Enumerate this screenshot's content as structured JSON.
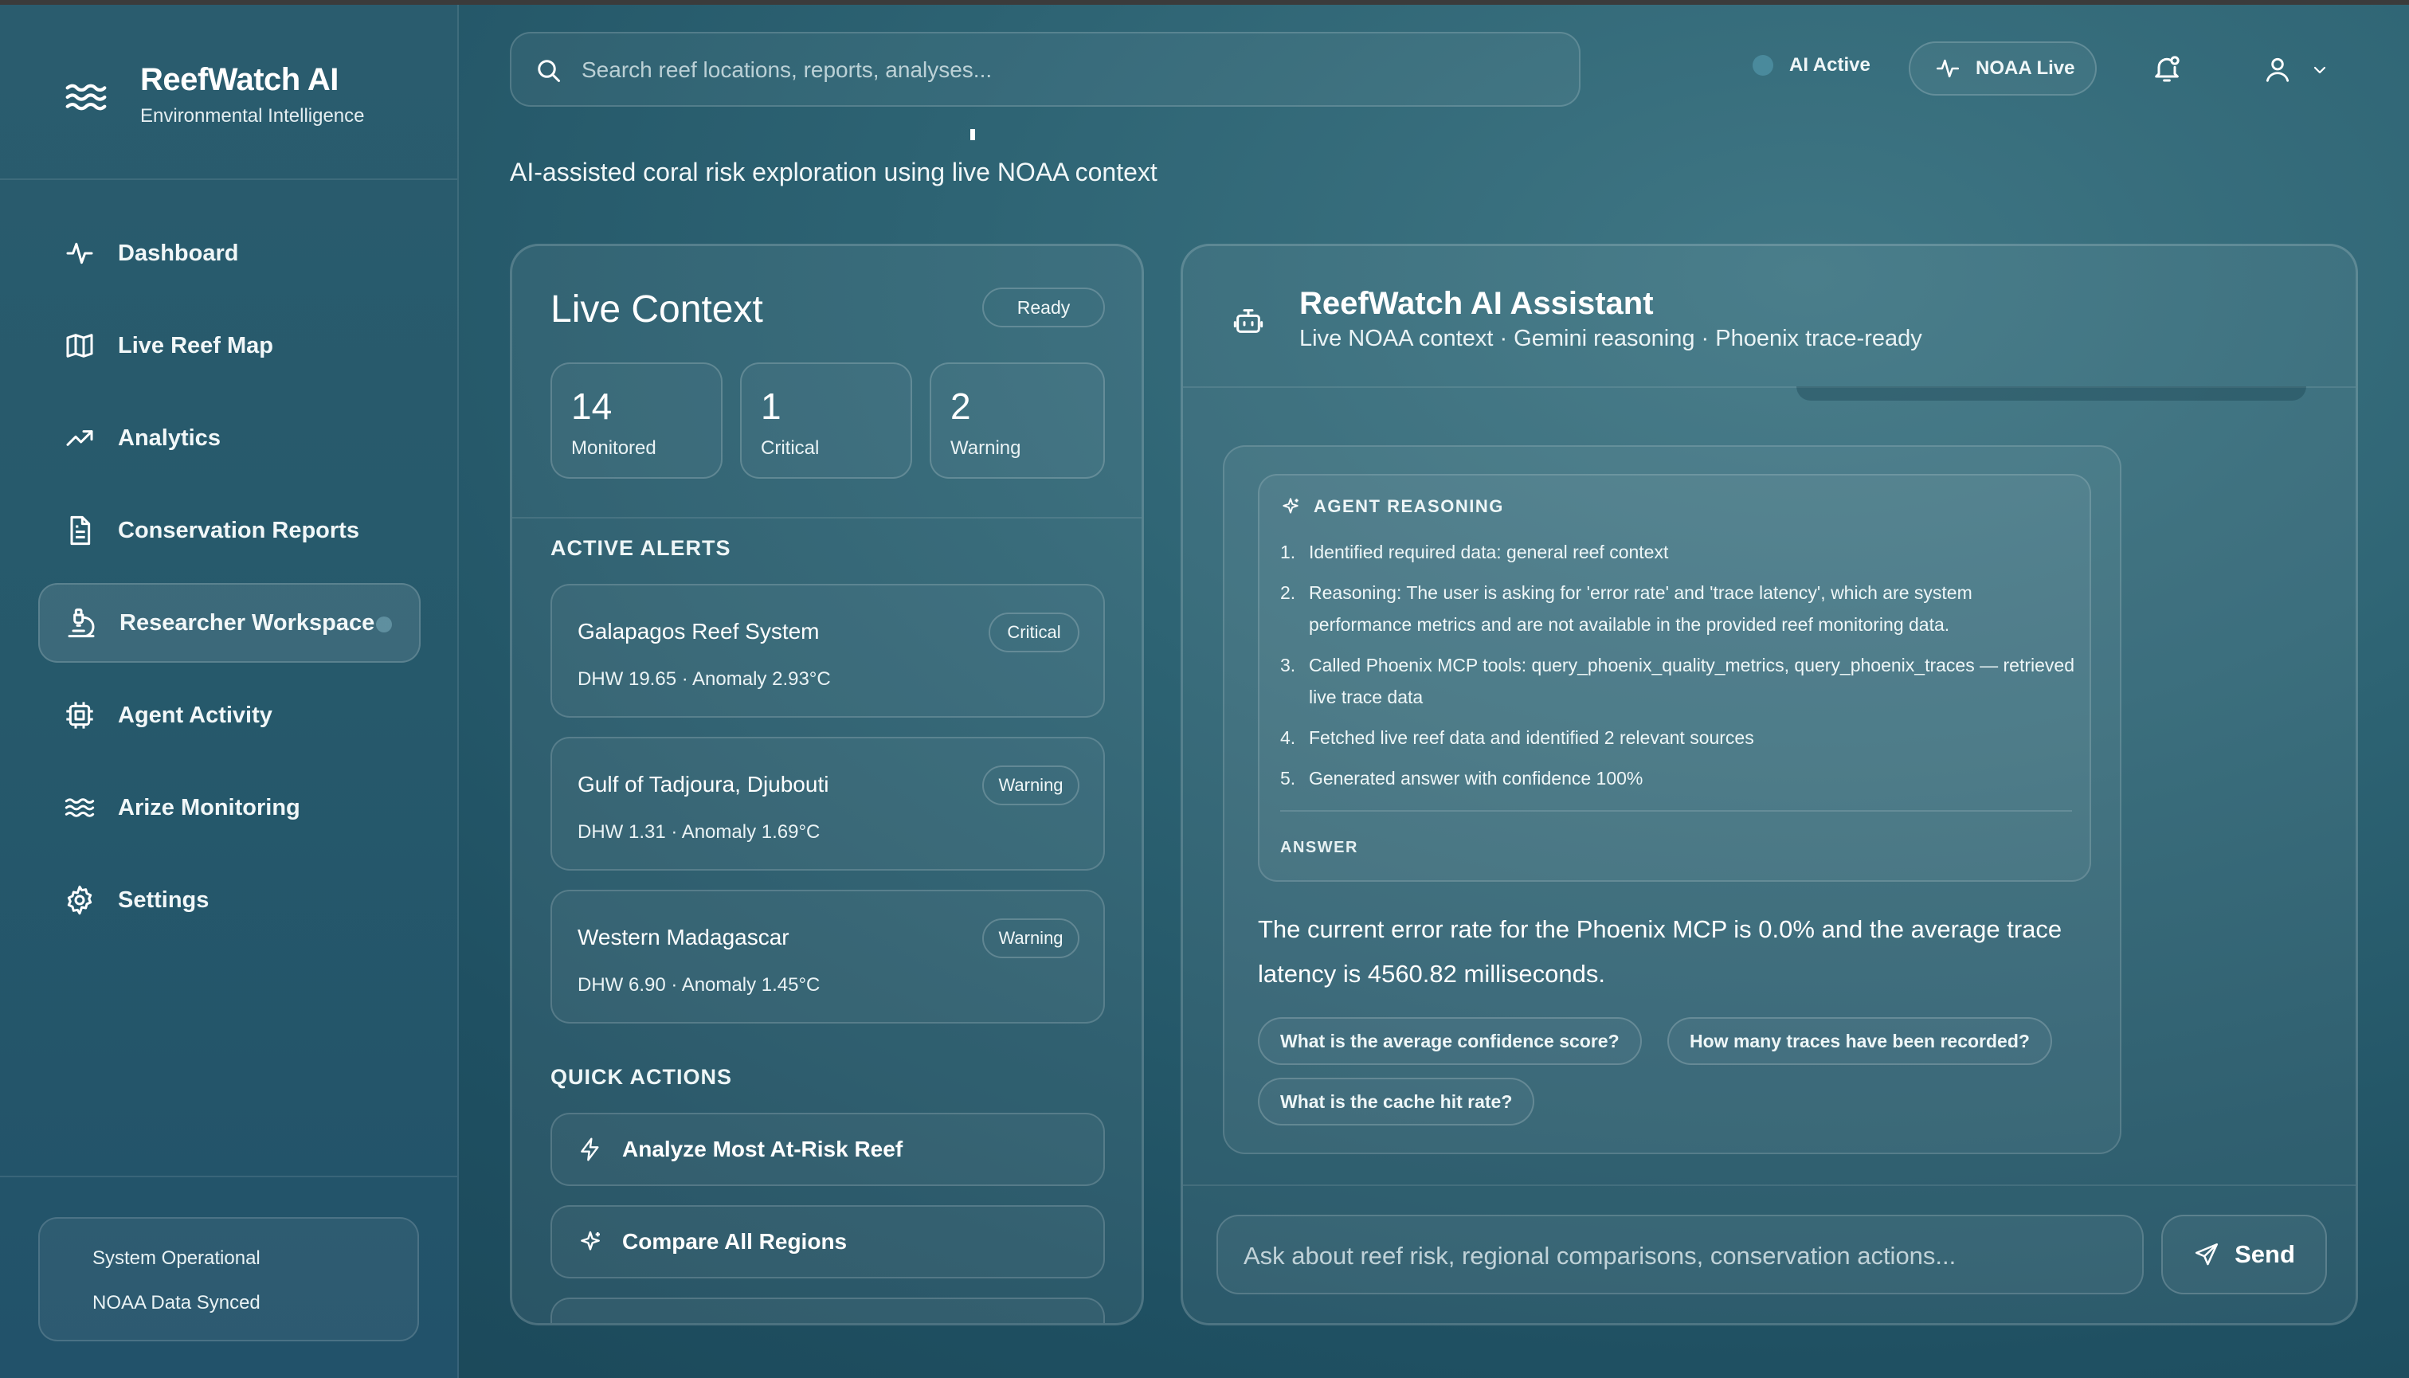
{
  "brand": {
    "title": "ReefWatch AI",
    "subtitle": "Environmental Intelligence"
  },
  "nav": [
    {
      "label": "Dashboard",
      "icon": "activity-icon"
    },
    {
      "label": "Live Reef Map",
      "icon": "map-icon"
    },
    {
      "label": "Analytics",
      "icon": "trend-icon"
    },
    {
      "label": "Conservation Reports",
      "icon": "file-icon"
    },
    {
      "label": "Researcher Workspace",
      "icon": "microscope-icon",
      "active": true
    },
    {
      "label": "Agent Activity",
      "icon": "cpu-icon"
    },
    {
      "label": "Arize Monitoring",
      "icon": "waves-icon"
    },
    {
      "label": "Settings",
      "icon": "gear-icon"
    }
  ],
  "status": {
    "line1": "System Operational",
    "line2": "NOAA Data Synced"
  },
  "header": {
    "search_placeholder": "Search reef locations, reports, analyses...",
    "ai_status": "AI Active",
    "noaa_label": "NOAA Live"
  },
  "page": {
    "subtitle": "AI-assisted coral risk exploration using live NOAA context"
  },
  "context": {
    "title": "Live Context",
    "badge": "Ready",
    "stats": [
      {
        "value": "14",
        "label": "Monitored"
      },
      {
        "value": "1",
        "label": "Critical"
      },
      {
        "value": "2",
        "label": "Warning"
      }
    ],
    "alerts_heading": "ACTIVE ALERTS",
    "alerts": [
      {
        "name": "Galapagos Reef System",
        "meta": "DHW 19.65 · Anomaly 2.93°C",
        "severity": "Critical"
      },
      {
        "name": "Gulf of Tadjoura, Djubouti",
        "meta": "DHW 1.31 · Anomaly 1.69°C",
        "severity": "Warning"
      },
      {
        "name": "Western Madagascar",
        "meta": "DHW 6.90 · Anomaly 1.45°C",
        "severity": "Warning"
      }
    ],
    "actions_heading": "QUICK ACTIONS",
    "actions": [
      {
        "label": "Analyze Most At-Risk Reef"
      },
      {
        "label": "Compare All Regions"
      }
    ]
  },
  "assistant": {
    "title": "ReefWatch AI Assistant",
    "subtitle": "Live NOAA context · Gemini reasoning · Phoenix trace-ready",
    "reasoning_heading": "AGENT REASONING",
    "steps": [
      {
        "n": "1.",
        "text": "Identified required data: general reef context"
      },
      {
        "n": "2.",
        "text": "Reasoning: The user is asking for 'error rate' and 'trace latency', which are system performance metrics and are not available in the provided reef monitoring data."
      },
      {
        "n": "3.",
        "text": "Called Phoenix MCP tools: query_phoenix_quality_metrics, query_phoenix_traces — retrieved live trace data"
      },
      {
        "n": "4.",
        "text": "Fetched live reef data and identified 2 relevant sources"
      },
      {
        "n": "5.",
        "text": "Generated answer with confidence 100%"
      }
    ],
    "answer_heading": "ANSWER",
    "answer": "The current error rate for the Phoenix MCP is 0.0% and the average trace latency is 4560.82 milliseconds.",
    "suggestions": [
      "What is the average confidence score?",
      "How many traces have been recorded?",
      "What is the cache hit rate?"
    ],
    "input_placeholder": "Ask about reef risk, regional comparisons, conservation actions...",
    "send_label": "Send"
  }
}
